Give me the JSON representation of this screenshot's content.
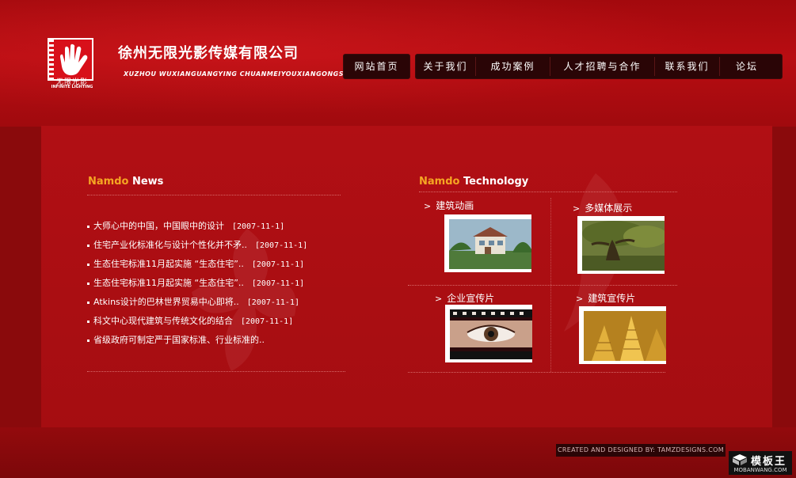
{
  "header": {
    "logo_text_cn": "无限光影",
    "logo_text_en": "INFINITE LIGHTING",
    "company_name_cn": "徐州无限光影传媒有限公司",
    "company_name_en": "XUZHOU WUXIANGUANGYING CHUANMEIYOUXIANGONGSI"
  },
  "nav": {
    "home": "网站首页",
    "items": [
      {
        "label": "关于我们"
      },
      {
        "label": "成功案例"
      },
      {
        "label": "人才招聘与合作"
      },
      {
        "label": "联系我们"
      },
      {
        "label": "论坛"
      }
    ]
  },
  "news": {
    "title_brand": "Namdo",
    "title_word": "News",
    "items": [
      {
        "text": "大师心中的中国，中国眼中的设计",
        "date": "[2007-11-1]"
      },
      {
        "text": "住宅产业化标准化与设计个性化并不矛..",
        "date": "[2007-11-1]"
      },
      {
        "text": "生态住宅标准11月起实施 “生态住宅”..",
        "date": "[2007-11-1]"
      },
      {
        "text": "生态住宅标准11月起实施 “生态住宅”..",
        "date": "[2007-11-1]"
      },
      {
        "text": "Atkins设计的巴林世界贸易中心即将..",
        "date": "[2007-11-1]"
      },
      {
        "text": "科文中心现代建筑与传统文化的结合",
        "date": "[2007-11-1]"
      },
      {
        "text": "省级政府可制定严于国家标准、行业标准的..",
        "date": ""
      }
    ]
  },
  "technology": {
    "title_brand": "Namdo",
    "title_word": "Technology",
    "items": [
      {
        "label": "建筑动画"
      },
      {
        "label": "多媒体展示"
      },
      {
        "label": "企业宣传片"
      },
      {
        "label": "建筑宣传片"
      }
    ]
  },
  "footer": {
    "credit": "CREATED AND DESIGNED BY: TAMZDESIGNS.COM",
    "watermark_cn": "模板王",
    "watermark_en": "MOBANWANG.COM"
  },
  "colors": {
    "background": "#8a0a0c",
    "panel": "#ad0f13",
    "accent": "#f5a623",
    "nav_bg": "#2a0506"
  }
}
